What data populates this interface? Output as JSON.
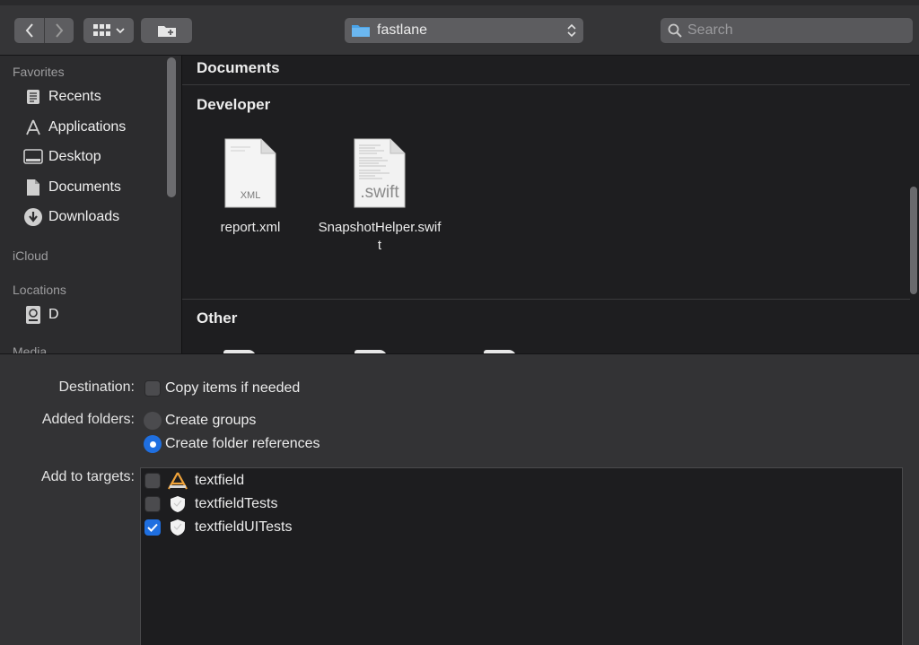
{
  "toolbar": {
    "path_folder": "fastlane",
    "search_placeholder": "Search"
  },
  "sidebar": {
    "favorites_header": "Favorites",
    "favorites": [
      {
        "label": "Recents",
        "icon": "recents-icon"
      },
      {
        "label": "Applications",
        "icon": "applications-icon"
      },
      {
        "label": "Desktop",
        "icon": "desktop-icon"
      },
      {
        "label": "Documents",
        "icon": "documents-icon"
      },
      {
        "label": "Downloads",
        "icon": "downloads-icon"
      }
    ],
    "icloud_header": "iCloud",
    "locations_header": "Locations",
    "locations": [
      {
        "label": "D",
        "icon": "disk-icon"
      }
    ],
    "media_header": "Media"
  },
  "content": {
    "sections": [
      {
        "title": "Documents"
      },
      {
        "title": "Developer"
      },
      {
        "title": "Other"
      }
    ],
    "developer_files": [
      {
        "name": "report.xml",
        "badge": "XML"
      },
      {
        "name": "SnapshotHelper.swift",
        "badge": ".swift"
      }
    ]
  },
  "options": {
    "destination_label": "Destination:",
    "copy_items_label": "Copy items if needed",
    "copy_items_checked": false,
    "added_folders_label": "Added folders:",
    "create_groups_label": "Create groups",
    "create_folder_refs_label": "Create folder references",
    "selected_folder_option": "Create folder references",
    "add_targets_label": "Add to targets:",
    "targets": [
      {
        "name": "textfield",
        "checked": false,
        "icon": "app-target-icon"
      },
      {
        "name": "textfieldTests",
        "checked": false,
        "icon": "test-target-icon"
      },
      {
        "name": "textfieldUITests",
        "checked": true,
        "icon": "test-target-icon"
      }
    ]
  },
  "colors": {
    "accent": "#1f6fe0",
    "window_bg": "#1e1e20",
    "sidebar_bg": "#2c2c2e",
    "toolbar_bg": "#353537",
    "folder_blue": "#4aa3e8"
  }
}
